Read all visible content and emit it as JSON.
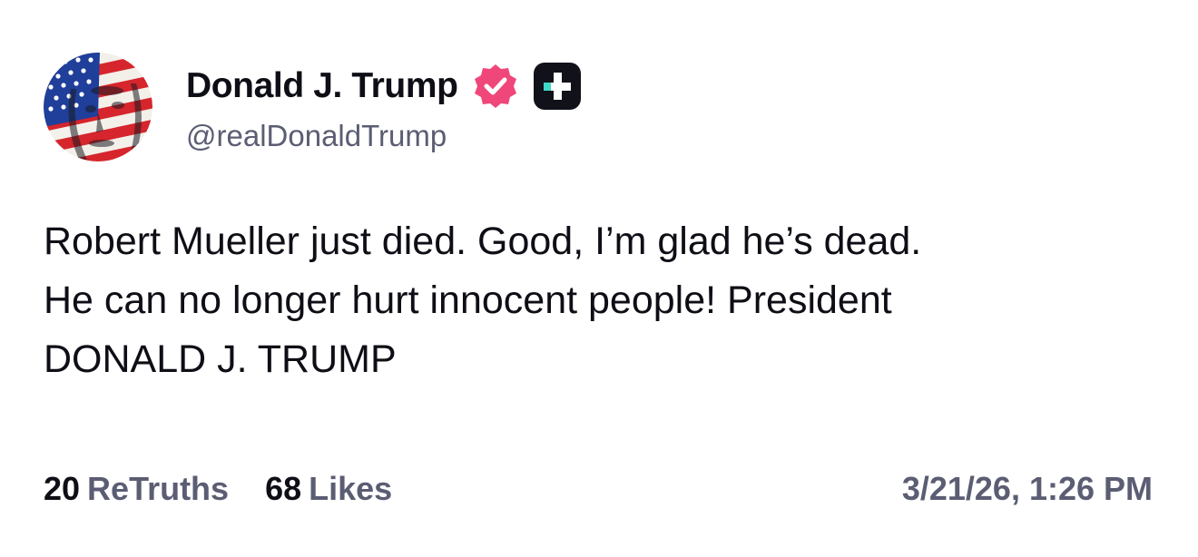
{
  "author": {
    "display_name": "Donald J. Trump",
    "handle": "@realDonaldTrump",
    "verified_icon": "verified-badge-icon",
    "verified_color": "#f0477a",
    "plus_icon": "plus-badge-icon",
    "plus_color": "#11111a",
    "plus_accent": "#3fd9c6"
  },
  "post": {
    "text_lines": [
      "Robert Mueller just died. Good, I’m glad he’s dead.",
      "He can no longer hurt innocent people! President",
      "DONALD J. TRUMP"
    ]
  },
  "stats": {
    "retruths_count": "20",
    "retruths_label": "ReTruths",
    "likes_count": "68",
    "likes_label": "Likes"
  },
  "timestamp": "3/21/26, 1:26 PM"
}
